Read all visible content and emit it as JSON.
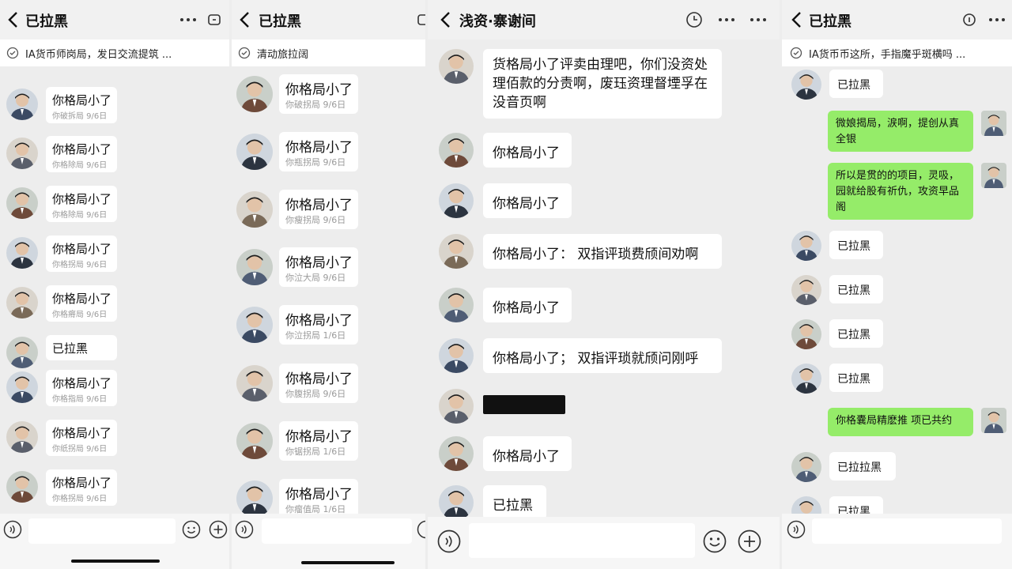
{
  "panel1": {
    "title": "已拉黑",
    "banner": "IA货币师岗局，发日交流提筑 ...",
    "messages": [
      {
        "text": "你格局小了",
        "sub": "你破拆局 9/6日"
      },
      {
        "text": "你格局小了",
        "sub": "你格除局 9/6日"
      },
      {
        "text": "你格局小了",
        "sub": "你格除局 9/6日"
      },
      {
        "text": "你格局小了",
        "sub": "你格拐局 9/6日"
      },
      {
        "text": "你格局小了",
        "sub": "你格瘠局 9/6日"
      },
      {
        "text": "已拉黑",
        "sub": ""
      },
      {
        "text": "你格局小了",
        "sub": "你格指局 9/6日"
      },
      {
        "text": "你格局小了",
        "sub": "你纸拐局 9/6日"
      },
      {
        "text": "你格局小了",
        "sub": "你格拐局 9/6日"
      }
    ]
  },
  "panel2": {
    "title": "已拉黑",
    "banner": "清动旅拉阔",
    "messages": [
      {
        "text": "你格局小了",
        "sub": "你破拐局 9/6日"
      },
      {
        "text": "你格局小了",
        "sub": "你瓶拐局 9/6日"
      },
      {
        "text": "你格局小了",
        "sub": "你瘦拐局 9/6日"
      },
      {
        "text": "你格局小了",
        "sub": "你泣大局 9/6日"
      },
      {
        "text": "你格局小了",
        "sub": "你泣拐局 1/6日"
      },
      {
        "text": "你格局小了",
        "sub": "你腹拐局 9/6日"
      },
      {
        "text": "你格局小了",
        "sub": "你锯拐局 1/6日"
      },
      {
        "text": "你格局小了",
        "sub": "你瘤值局 1/6日"
      }
    ]
  },
  "panel3": {
    "title": "浅资·寨谢间",
    "messages": [
      {
        "text": "货格局小了评卖由理吧，你们没资处理佰款的分责啊，废珏资理督堙孚在没音页啊"
      },
      {
        "text": "你格局小了"
      },
      {
        "text": "你格局小了"
      },
      {
        "text": "你格局小了：  双指评琐费颀间劝啊"
      },
      {
        "text": "你格局小了"
      },
      {
        "text": "你格局小了；  双指评琐就颀问刚呼"
      },
      {
        "text": ""
      },
      {
        "text": "你格局小了"
      },
      {
        "text": "已拉黑"
      }
    ]
  },
  "panel4": {
    "title": "已拉黑",
    "banner": "IA货币币这所，手指魔乎斑横吗 ...",
    "messages": [
      {
        "side": "left",
        "text": "已拉黑"
      },
      {
        "side": "right",
        "text": "微娘揭局，涙啊，提创从真全银"
      },
      {
        "side": "right",
        "text": "所以是贯的的项目，灵吸，园就给股有祈仇，攻资早品阁"
      },
      {
        "side": "left",
        "text": "已拉黑"
      },
      {
        "side": "left",
        "text": "已拉黑"
      },
      {
        "side": "left",
        "text": "已拉黑"
      },
      {
        "side": "left",
        "text": "已拉黑"
      },
      {
        "side": "right",
        "text": "你格囊局精麽推 项已共约"
      },
      {
        "side": "left",
        "text": "已拉拉黑"
      },
      {
        "side": "left",
        "text": "已拉黑"
      }
    ]
  },
  "icons": {
    "back": "chevron-left-icon",
    "more": "more-dots-icon",
    "voice": "voice-icon",
    "emoji": "emoji-icon",
    "plus": "plus-icon"
  },
  "colors": {
    "background": "#ededed",
    "bubble_self": "#95ec69",
    "bubble_other": "#ffffff",
    "avatar_palette": [
      "#3b4a63",
      "#5a5f6b",
      "#6e4a3a",
      "#2c3440",
      "#7a6a58",
      "#4f5d75"
    ]
  }
}
